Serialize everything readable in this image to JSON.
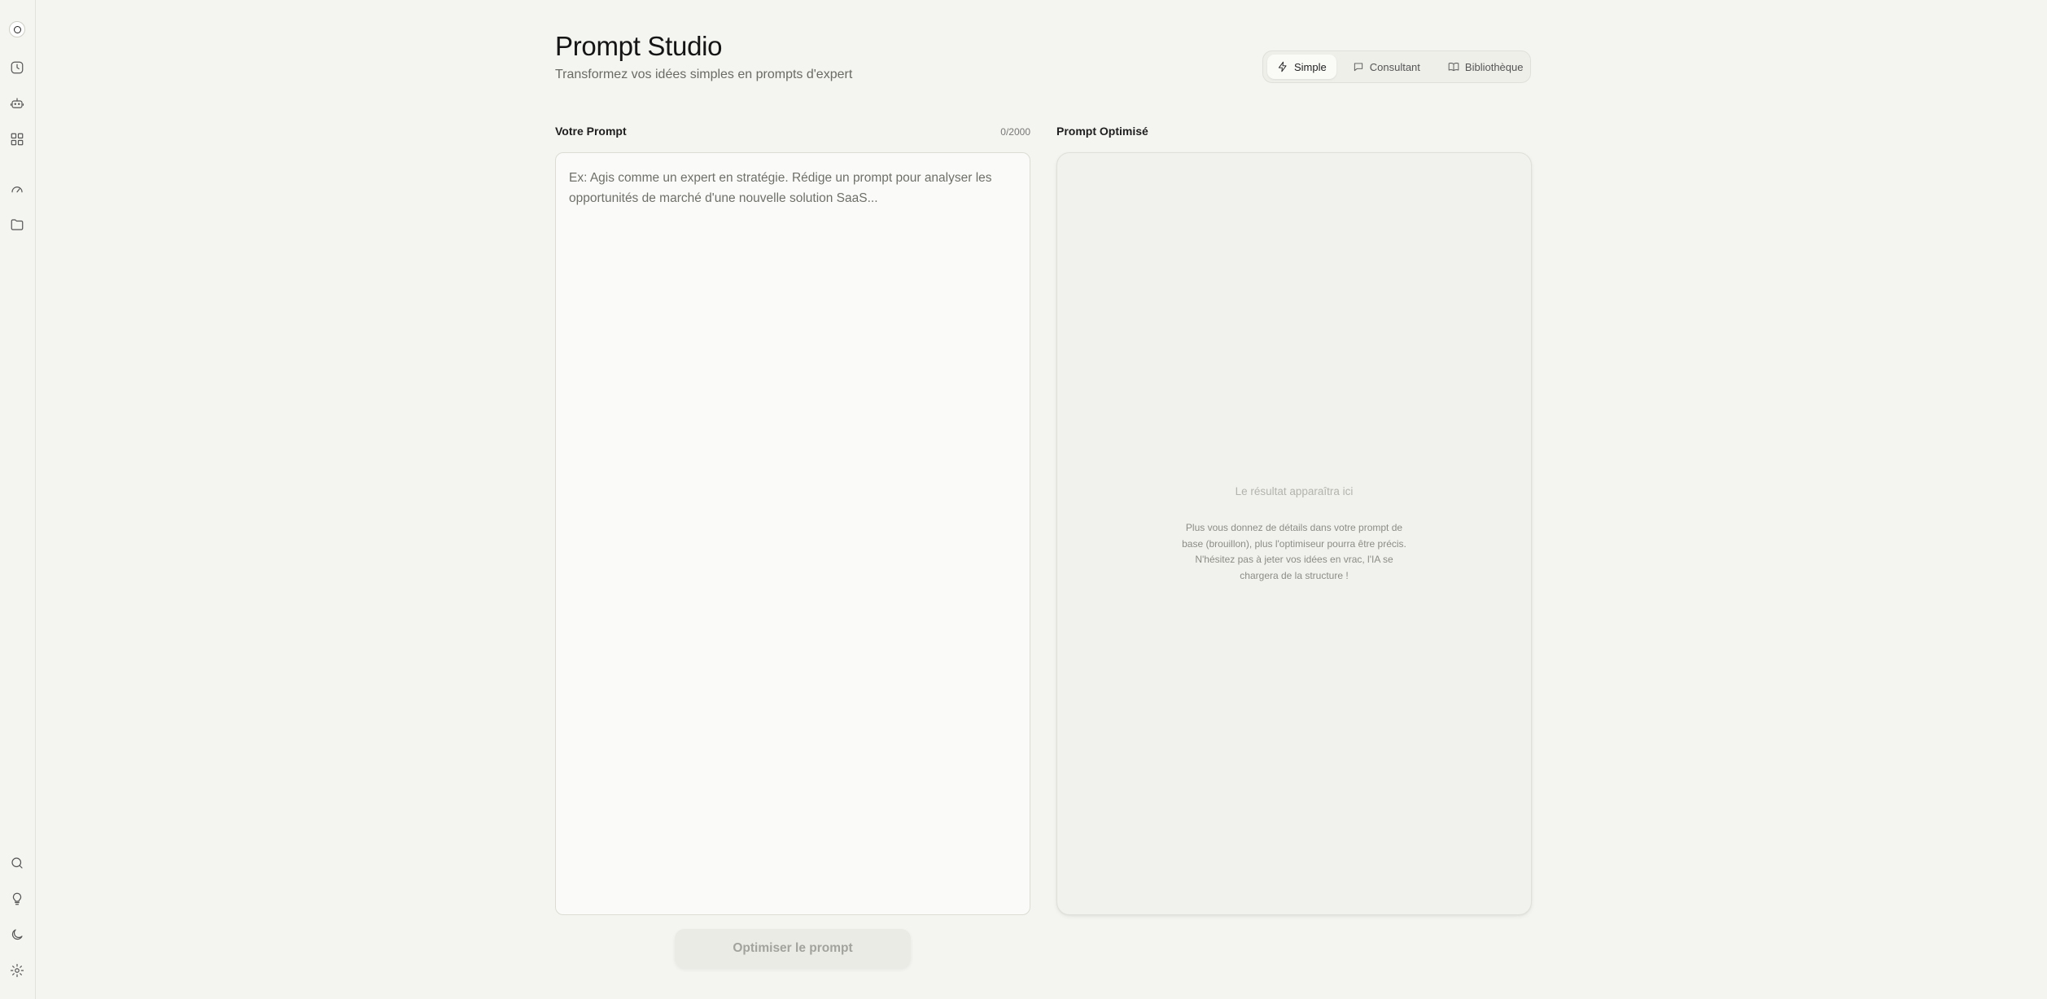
{
  "header": {
    "title": "Prompt Studio",
    "subtitle": "Transformez vos idées simples en prompts d'expert"
  },
  "modes": [
    {
      "label": "Simple",
      "icon": "lightning-icon",
      "active": true
    },
    {
      "label": "Consultant",
      "icon": "chat-bubble-icon",
      "active": false
    },
    {
      "label": "Bibliothèque",
      "icon": "book-icon",
      "active": false
    }
  ],
  "input": {
    "label": "Votre Prompt",
    "counter": "0/2000",
    "placeholder": "Ex: Agis comme un expert en stratégie. Rédige un prompt pour analyser les opportunités de marché d'une nouvelle solution SaaS...",
    "value": ""
  },
  "output": {
    "label": "Prompt Optimisé",
    "empty_title": "Le résultat apparaîtra ici",
    "empty_description": "Plus vous donnez de détails dans votre prompt de base (brouillon), plus l'optimiseur pourra être précis. N'hésitez pas à jeter vos idées en vrac, l'IA se chargera de la structure !"
  },
  "actions": {
    "optimize_label": "Optimiser le prompt"
  },
  "sidebar": {
    "top_icons": [
      "logo-icon",
      "history-icon",
      "bot-icon",
      "grid-icon",
      "gauge-icon",
      "folder-icon"
    ],
    "bottom_icons": [
      "search-icon",
      "lightbulb-icon",
      "moon-icon",
      "gear-icon"
    ]
  },
  "colors": {
    "background": "#f4f4f0",
    "panel": "#fafaf8",
    "accent_text": "#1a1a1a",
    "muted_text": "#6b6b66"
  }
}
